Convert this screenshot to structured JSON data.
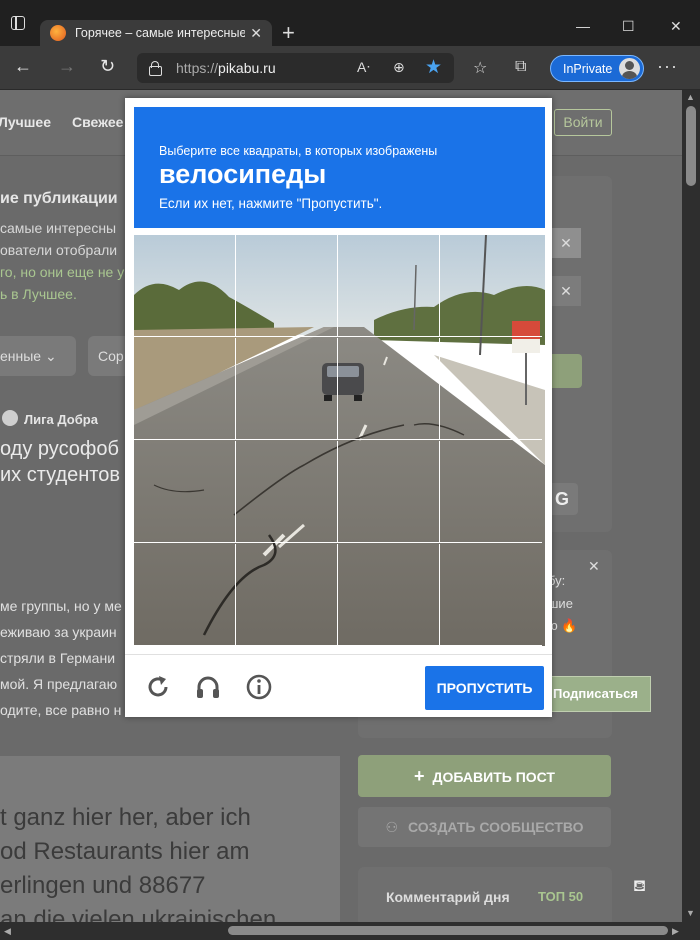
{
  "browser": {
    "tab_title": "Горячее – самые интересные и",
    "tab_close": "✕",
    "new_tab": "+",
    "win_min": "—",
    "win_max": "☐",
    "win_close": "✕",
    "url_proto": "https://",
    "url_host": "pikabu.ru",
    "inprivate_label": "InPrivate",
    "more": "···"
  },
  "page": {
    "nav": [
      {
        "label": "Лучшее"
      },
      {
        "label": "Свежее"
      }
    ],
    "login": "Войти",
    "section_title": "ие публикации",
    "section_lines": [
      "самые интересны",
      "ователи отобрали",
      "го, но они еще не у",
      "ь в Лучшее."
    ],
    "dropdown1": "енные",
    "dropdown2": "Сор",
    "post_author": "Лига Добра",
    "post_title_lines": [
      "оду русофоб",
      "их студентов"
    ],
    "post_body_lines": [
      "ме группы, но у ме",
      "еживаю за украин",
      "стряли в Германи",
      "мой. Я предлагаю",
      "одите, все равно н"
    ],
    "article_lines": [
      "t ganz hier her, aber ich",
      "od Restaurants hier am",
      "erlingen und 88677",
      "an die vielen ukrainischen"
    ],
    "side_close": "✕",
    "side_g": "G",
    "promo_lines": [
      "бу:",
      "шие",
      "ю 🔥"
    ],
    "subscribe": "Подписаться",
    "add_post": "ДОБАВИТЬ ПОСТ",
    "create_community": "СОЗДАТЬ СООБЩЕСТВО",
    "comment_day": "Комментарий дня",
    "comment_badge": "ТОП 50"
  },
  "captcha": {
    "instruction": "Выберите все квадраты, в которых изображены",
    "target": "велосипеды",
    "hint": "Если их нет, нажмите \"Пропустить\".",
    "skip_button": "ПРОПУСТИТЬ",
    "icons": [
      "reload-icon",
      "headphones-icon",
      "info-icon"
    ],
    "grid": {
      "rows": 4,
      "cols": 4
    },
    "accent_color": "#1a73e8"
  }
}
